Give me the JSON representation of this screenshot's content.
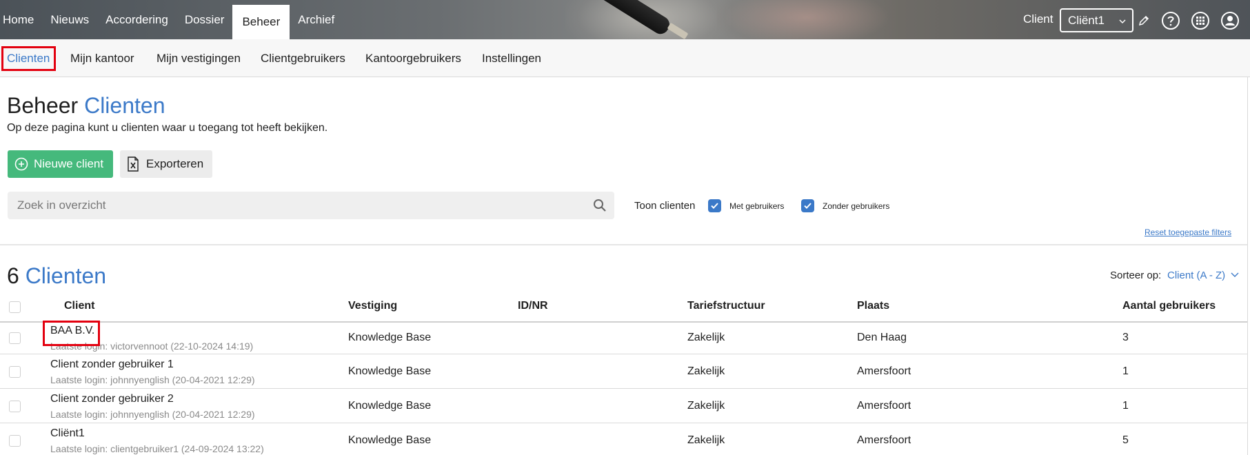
{
  "nav": {
    "items": [
      {
        "label": "Home"
      },
      {
        "label": "Nieuws"
      },
      {
        "label": "Accordering"
      },
      {
        "label": "Dossier"
      },
      {
        "label": "Beheer",
        "active": true
      },
      {
        "label": "Archief"
      }
    ]
  },
  "header": {
    "client_label": "Client",
    "client_select_value": "Cliënt1",
    "icons": [
      "pencil-icon",
      "help-icon",
      "apps-grid-icon",
      "user-icon"
    ]
  },
  "subnav": {
    "items": [
      {
        "label": "Clienten",
        "active": true
      },
      {
        "label": "Mijn kantoor"
      },
      {
        "label": "Mijn vestigingen"
      },
      {
        "label": "Clientgebruikers"
      },
      {
        "label": "Kantoorgebruikers"
      },
      {
        "label": "Instellingen"
      }
    ]
  },
  "page": {
    "title_prefix": "Beheer",
    "title_accent": "Clienten",
    "description": "Op deze pagina kunt u clienten waar u toegang tot heeft bekijken."
  },
  "actions": {
    "new_client": "Nieuwe client",
    "export": "Exporteren"
  },
  "search": {
    "placeholder": "Zoek in overzicht",
    "value": ""
  },
  "filters": {
    "label": "Toon clienten",
    "with_users": {
      "label": "Met gebruikers",
      "checked": true
    },
    "without_users": {
      "label": "Zonder gebruikers",
      "checked": true
    },
    "reset": "Reset toegepaste filters"
  },
  "list": {
    "count": "6",
    "title": "Clienten",
    "sort_label": "Sorteer op:",
    "sort_value": "Client (A - Z)",
    "columns": [
      "Client",
      "Vestiging",
      "ID/NR",
      "Tariefstructuur",
      "Plaats",
      "Aantal gebruikers"
    ],
    "rows": [
      {
        "name": "BAA B.V.",
        "login": "Laatste login: victorvennoot (22-10-2024 14:19)",
        "vestiging": "Knowledge Base",
        "idnr": "",
        "tarief": "Zakelijk",
        "plaats": "Den Haag",
        "aantal": "3"
      },
      {
        "name": "Client zonder gebruiker 1",
        "login": "Laatste login: johnnyenglish (20-04-2021 12:29)",
        "vestiging": "Knowledge Base",
        "idnr": "",
        "tarief": "Zakelijk",
        "plaats": "Amersfoort",
        "aantal": "1"
      },
      {
        "name": "Client zonder gebruiker 2",
        "login": "Laatste login: johnnyenglish (20-04-2021 12:29)",
        "vestiging": "Knowledge Base",
        "idnr": "",
        "tarief": "Zakelijk",
        "plaats": "Amersfoort",
        "aantal": "1"
      },
      {
        "name": "Cliënt1",
        "login": "Laatste login: clientgebruiker1 (24-09-2024 13:22)",
        "vestiging": "Knowledge Base",
        "idnr": "",
        "tarief": "Zakelijk",
        "plaats": "Amersfoort",
        "aantal": "5"
      }
    ]
  },
  "colors": {
    "accent": "#3b79c8",
    "success": "#45b97c",
    "highlight": "#e3000f"
  }
}
